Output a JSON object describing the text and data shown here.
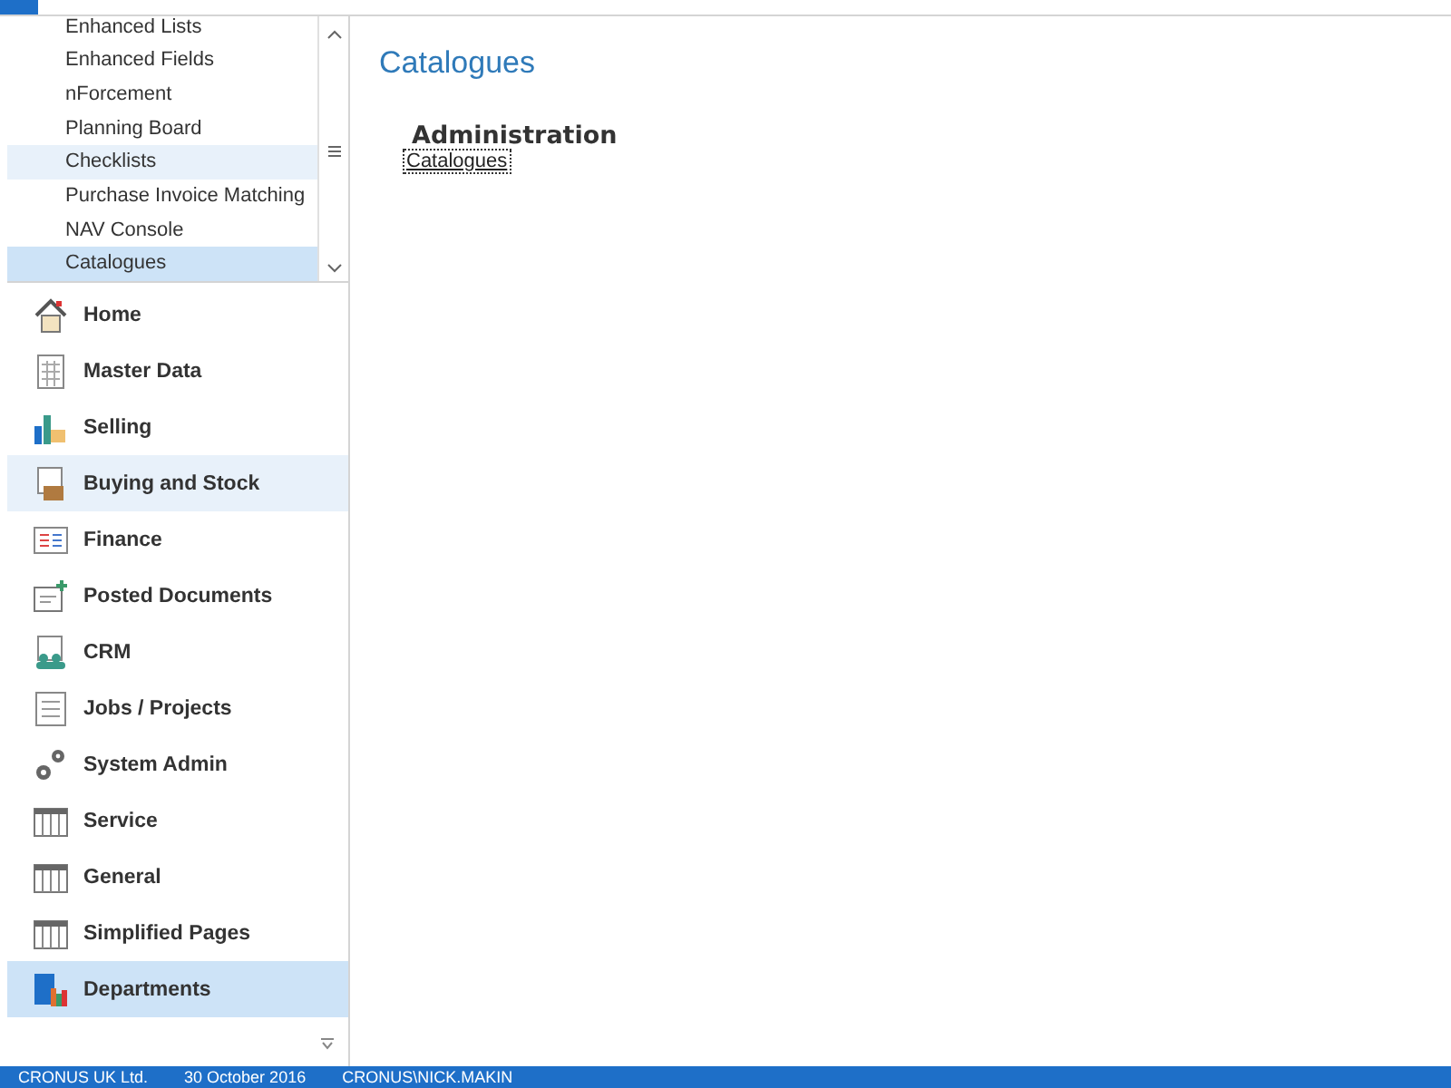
{
  "feature_list": {
    "items": [
      {
        "label": "Enhanced Lists",
        "selected": false,
        "hovered": false
      },
      {
        "label": "Enhanced Fields",
        "selected": false,
        "hovered": false
      },
      {
        "label": "nForcement",
        "selected": false,
        "hovered": false
      },
      {
        "label": "Planning Board",
        "selected": false,
        "hovered": false
      },
      {
        "label": "Checklists",
        "selected": false,
        "hovered": true
      },
      {
        "label": "Purchase Invoice Matching",
        "selected": false,
        "hovered": false
      },
      {
        "label": "NAV Console",
        "selected": false,
        "hovered": false
      },
      {
        "label": "Catalogues",
        "selected": true,
        "hovered": false
      }
    ]
  },
  "navigation": {
    "items": [
      {
        "label": "Home",
        "kind": "home",
        "selected": false,
        "hovered": false
      },
      {
        "label": "Master Data",
        "kind": "sheet",
        "selected": false,
        "hovered": false
      },
      {
        "label": "Selling",
        "kind": "chart",
        "selected": false,
        "hovered": false
      },
      {
        "label": "Buying and Stock",
        "kind": "box",
        "selected": false,
        "hovered": true
      },
      {
        "label": "Finance",
        "kind": "ledger",
        "selected": false,
        "hovered": false
      },
      {
        "label": "Posted Documents",
        "kind": "posted",
        "selected": false,
        "hovered": false
      },
      {
        "label": "CRM",
        "kind": "people",
        "selected": false,
        "hovered": false
      },
      {
        "label": "Jobs / Projects",
        "kind": "checklist",
        "selected": false,
        "hovered": false
      },
      {
        "label": "System Admin",
        "kind": "gears",
        "selected": false,
        "hovered": false
      },
      {
        "label": "Service",
        "kind": "table",
        "selected": false,
        "hovered": false
      },
      {
        "label": "General",
        "kind": "table",
        "selected": false,
        "hovered": false
      },
      {
        "label": "Simplified Pages",
        "kind": "table",
        "selected": false,
        "hovered": false
      },
      {
        "label": "Departments",
        "kind": "depts",
        "selected": true,
        "hovered": false
      }
    ]
  },
  "page": {
    "title": "Catalogues",
    "groups": [
      {
        "heading": "Administration",
        "links": [
          "Catalogues"
        ]
      }
    ]
  },
  "status_bar": {
    "company": "CRONUS UK Ltd.",
    "date": "30 October 2016",
    "user": "CRONUS\\NICK.MAKIN"
  }
}
